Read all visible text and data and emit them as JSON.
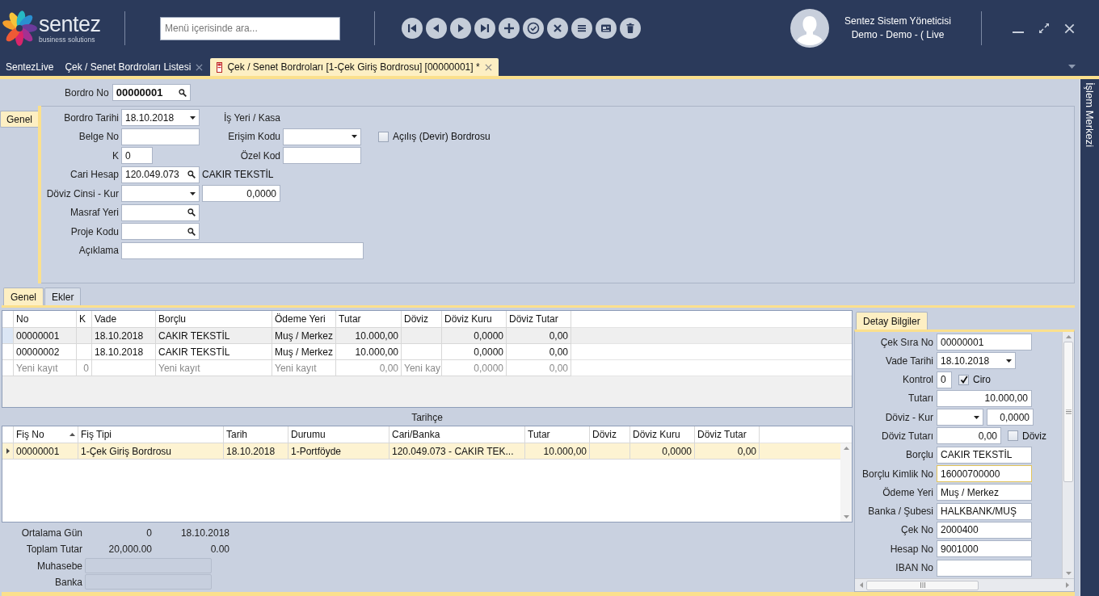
{
  "header": {
    "logo": {
      "name": "sentez",
      "tagline": "business solutions"
    },
    "search": {
      "placeholder": "Menü içerisinde ara..."
    },
    "toolbar": [
      {
        "kind": "first"
      },
      {
        "kind": "previous"
      },
      {
        "kind": "next"
      },
      {
        "kind": "last"
      },
      {
        "kind": "add"
      },
      {
        "kind": "approve"
      },
      {
        "kind": "cancel"
      },
      {
        "kind": "list"
      },
      {
        "kind": "card"
      },
      {
        "kind": "delete"
      }
    ],
    "user": {
      "name": "Sentez Sistem Yöneticisi",
      "context": "Demo - Demo - ( Live"
    }
  },
  "tabs": [
    {
      "label": "SentezLive",
      "selected": false,
      "closable": false
    },
    {
      "label": "Çek / Senet Bordroları Listesi",
      "selected": false,
      "closable": true
    },
    {
      "label": "Çek / Senet Bordroları [1-Çek Giriş Bordrosu]  [00000001]  *",
      "selected": true,
      "closable": true
    }
  ],
  "side_panel": {
    "title": "İşlem Merkezi"
  },
  "bordro_no": {
    "label": "Bordro No",
    "field": {
      "kind": "lookup",
      "value": "00000001"
    }
  },
  "header_form": {
    "side_tab": {
      "label": "Genel",
      "selected": true
    },
    "rows": [
      {
        "items": [
          {
            "kind": "label",
            "text": "Bordro Tarihi"
          },
          {
            "kind": "date",
            "value": "18.10.2018"
          },
          {
            "kind": "label",
            "text": "İş Yeri / Kasa"
          }
        ]
      },
      {
        "items": [
          {
            "kind": "label",
            "text": "Belge No"
          },
          {
            "kind": "text"
          },
          {
            "kind": "label",
            "text": "Erişim Kodu"
          },
          {
            "kind": "combo"
          },
          {
            "kind": "checkbox",
            "text": "Açılış (Devir) Bordrosu",
            "checked": false
          }
        ]
      },
      {
        "items": [
          {
            "kind": "label",
            "text": "K"
          },
          {
            "kind": "short",
            "value": "0"
          },
          {
            "kind": "label",
            "text": "Özel Kod"
          },
          {
            "kind": "text"
          }
        ]
      },
      {
        "items": [
          {
            "kind": "label",
            "text": "Cari Hesap"
          },
          {
            "kind": "lookup",
            "value": "120.049.073"
          },
          {
            "kind": "caption",
            "text": "CAKIR TEKSTİL"
          }
        ]
      },
      {
        "items": [
          {
            "kind": "label",
            "text": "Döviz Cinsi - Kur"
          },
          {
            "kind": "combo"
          },
          {
            "kind": "number",
            "value": "0,0000"
          }
        ]
      },
      {
        "items": [
          {
            "kind": "label",
            "text": "Masraf Yeri"
          },
          {
            "kind": "lookup"
          }
        ]
      },
      {
        "items": [
          {
            "kind": "label",
            "text": "Proje Kodu"
          },
          {
            "kind": "lookup"
          }
        ]
      },
      {
        "items": [
          {
            "kind": "label",
            "text": "Açıklama"
          },
          {
            "kind": "memo"
          }
        ]
      }
    ]
  },
  "section_tabs": [
    {
      "label": "Genel",
      "selected": true
    },
    {
      "label": "Ekler",
      "selected": false
    }
  ],
  "cheque_grid": {
    "columns": [
      "No",
      "K",
      "Vade",
      "Borçlu",
      "Ödeme Yeri",
      "Tutar",
      "Döviz",
      "Döviz Kuru",
      "Döviz Tutar"
    ],
    "rows": [
      {
        "kind": "data",
        "selected": true,
        "cells": [
          "00000001",
          null,
          "18.10.2018",
          "CAKIR TEKSTİL",
          "Muş / Merkez",
          "10.000,00",
          null,
          "0,0000",
          "0,00"
        ]
      },
      {
        "kind": "data",
        "selected": false,
        "cells": [
          "00000002",
          null,
          "18.10.2018",
          "CAKIR TEKSTİL",
          "Muş / Merkez",
          "10.000,00",
          null,
          "0,0000",
          "0,00"
        ]
      },
      {
        "kind": "new",
        "selected": false,
        "cells": [
          "Yeni kayıt",
          "0",
          null,
          "Yeni kayıt",
          "Yeni kayıt",
          "0,00",
          "Yeni kay",
          "0,0000",
          "0,00"
        ]
      }
    ]
  },
  "history_grid": {
    "title": "Tarihçe",
    "columns": [
      {
        "label": "Fiş No",
        "sorted": true
      },
      {
        "label": "Fiş Tipi",
        "sorted": false
      },
      {
        "label": "Tarih",
        "sorted": false
      },
      {
        "label": "Durumu",
        "sorted": false
      },
      {
        "label": "Cari/Banka",
        "sorted": false
      },
      {
        "label": "Tutar",
        "sorted": false
      },
      {
        "label": "Döviz",
        "sorted": false
      },
      {
        "label": "Döviz Kuru",
        "sorted": false
      },
      {
        "label": "Döviz Tutar",
        "sorted": false
      }
    ],
    "rows": [
      {
        "kind": "data",
        "selected": true,
        "cells": [
          "00000001",
          "1-Çek Giriş Bordrosu",
          "18.10.2018",
          "1-Portföyde",
          "120.049.073 - CAKIR TEK...",
          "10.000,00",
          null,
          "0,0000",
          "0,00"
        ]
      }
    ]
  },
  "summary": {
    "rows": [
      {
        "kind": "values",
        "label": "Ortalama Gün",
        "values": [
          "0",
          "18.10.2018"
        ]
      },
      {
        "kind": "values",
        "label": "Toplam Tutar",
        "values": [
          "20,000.00",
          "0.00"
        ]
      },
      {
        "kind": "box",
        "label": "Muhasebe"
      },
      {
        "kind": "box",
        "label": "Banka"
      }
    ]
  },
  "detail": {
    "tab": {
      "label": "Detay Bilgiler",
      "selected": true
    },
    "rows": [
      {
        "label": "Çek Sıra No",
        "items": [
          {
            "kind": "text",
            "value": "00000001",
            "focused": false
          }
        ]
      },
      {
        "label": "Vade Tarihi",
        "items": [
          {
            "kind": "date",
            "value": "18.10.2018"
          }
        ]
      },
      {
        "label": "Kontrol",
        "items": [
          {
            "kind": "short",
            "value": "0"
          },
          {
            "kind": "checkbox",
            "text": "Ciro",
            "checked": true
          }
        ]
      },
      {
        "label": "Tutarı",
        "items": [
          {
            "kind": "number",
            "value": "10.000,00"
          }
        ]
      },
      {
        "label": "Döviz - Kur",
        "items": [
          {
            "kind": "combo"
          },
          {
            "kind": "number",
            "value": "0,0000"
          }
        ]
      },
      {
        "label": "Döviz Tutarı",
        "items": [
          {
            "kind": "number",
            "value": "0,00"
          },
          {
            "kind": "checkbox",
            "text": "Döviz",
            "checked": false
          }
        ]
      },
      {
        "label": "Borçlu",
        "items": [
          {
            "kind": "text",
            "value": "CAKIR TEKSTİL",
            "focused": false
          }
        ]
      },
      {
        "label": "Borçlu Kimlik No",
        "items": [
          {
            "kind": "text",
            "value": "16000700000",
            "focused": true
          }
        ]
      },
      {
        "label": "Ödeme Yeri",
        "items": [
          {
            "kind": "text",
            "value": "Muş / Merkez",
            "focused": false
          }
        ]
      },
      {
        "label": "Banka / Şubesi",
        "items": [
          {
            "kind": "text",
            "value": "HALKBANK/MUŞ",
            "focused": false
          }
        ]
      },
      {
        "label": "Çek No",
        "items": [
          {
            "kind": "text",
            "value": "2000400",
            "focused": false
          }
        ]
      },
      {
        "label": "Hesap No",
        "items": [
          {
            "kind": "text",
            "value": "9001000",
            "focused": false
          }
        ]
      },
      {
        "label": "IBAN No",
        "items": [
          {
            "kind": "text",
            "focused": false
          }
        ]
      }
    ]
  }
}
